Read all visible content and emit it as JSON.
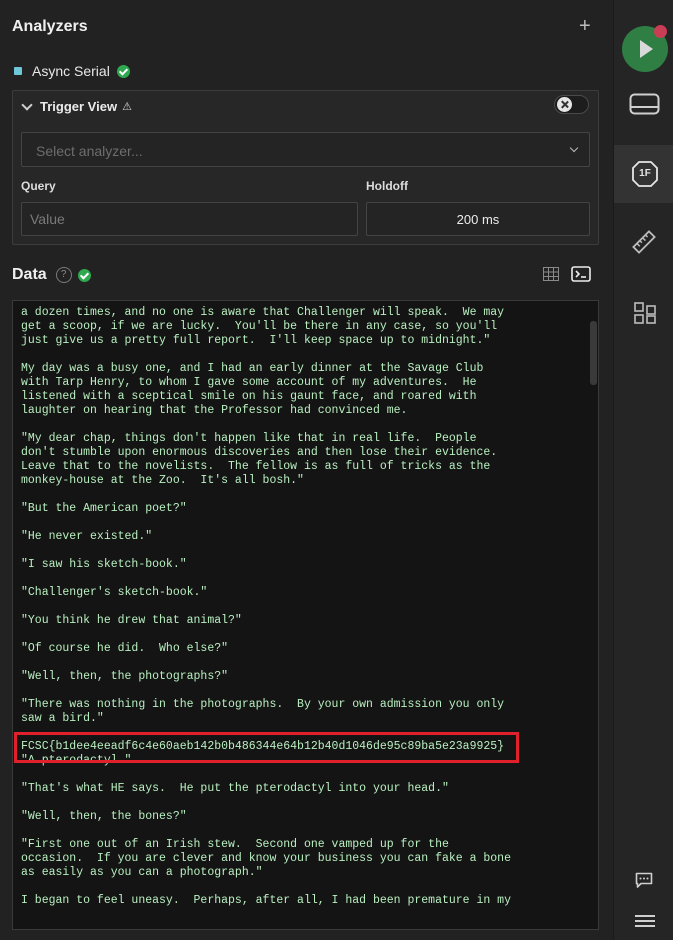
{
  "analyzers": {
    "title": "Analyzers",
    "add_label": "+",
    "items": [
      {
        "name": "Async Serial",
        "color": "#6fc8d8",
        "status": "ok"
      }
    ]
  },
  "trigger_view": {
    "title": "Trigger View",
    "warning_icon": "⚠",
    "enabled": false,
    "select_placeholder": "Select analyzer...",
    "query_label": "Query",
    "query_placeholder": "Value",
    "holdoff_label": "Holdoff",
    "holdoff_value": "200 ms"
  },
  "data_section": {
    "title": "Data",
    "help_label": "?",
    "status": "ok",
    "view_modes": [
      "table-view-icon",
      "terminal-view-icon"
    ],
    "active_view": "terminal"
  },
  "terminal_text": "a dozen times, and no one is aware that Challenger will speak.  We may\nget a scoop, if we are lucky.  You'll be there in any case, so you'll\njust give us a pretty full report.  I'll keep space up to midnight.\"\n\nMy day was a busy one, and I had an early dinner at the Savage Club\nwith Tarp Henry, to whom I gave some account of my adventures.  He\nlistened with a sceptical smile on his gaunt face, and roared with\nlaughter on hearing that the Professor had convinced me.\n\n\"My dear chap, things don't happen like that in real life.  People\ndon't stumble upon enormous discoveries and then lose their evidence.\nLeave that to the novelists.  The fellow is as full of tricks as the\nmonkey-house at the Zoo.  It's all bosh.\"\n\n\"But the American poet?\"\n\n\"He never existed.\"\n\n\"I saw his sketch-book.\"\n\n\"Challenger's sketch-book.\"\n\n\"You think he drew that animal?\"\n\n\"Of course he did.  Who else?\"\n\n\"Well, then, the photographs?\"\n\n\"There was nothing in the photographs.  By your own admission you only\nsaw a bird.\"\n\nFCSC{b1dee4eeadf6c4e60aeb142b0b486344e64b12b40d1046de95c89ba5e23a9925}\n\"A pterodactyl.\"\n\n\"That's what HE says.  He put the pterodactyl into your head.\"\n\n\"Well, then, the bones?\"\n\n\"First one out of an Irish stew.  Second one vamped up for the\noccasion.  If you are clever and know your business you can fake a bone\nas easily as you can a photograph.\"\n\nI began to feel uneasy.  Perhaps, after all, I had been premature in my",
  "highlight_color": "#e0202a",
  "sidebar": {
    "items": [
      {
        "icon": "play-icon",
        "badge": true,
        "accent": "#2f7f45"
      },
      {
        "icon": "device-icon"
      },
      {
        "icon": "analyzers-icon",
        "active": true,
        "label": "1F"
      },
      {
        "icon": "ruler-icon"
      },
      {
        "icon": "extensions-icon"
      },
      {
        "icon": "chat-icon"
      },
      {
        "icon": "menu-icon"
      }
    ]
  }
}
